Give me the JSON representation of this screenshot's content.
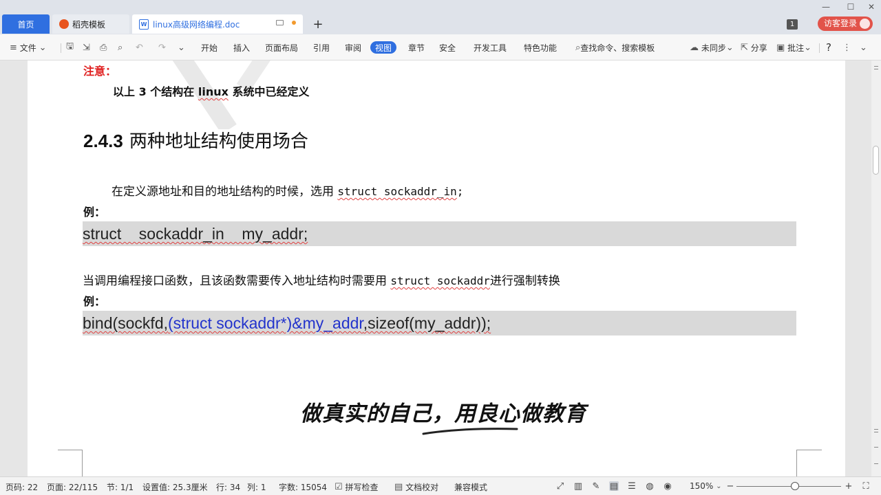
{
  "tabs": {
    "home": "首页",
    "templates": "稻壳模板",
    "document": "linux高级网络编程.doc",
    "add": "+"
  },
  "window": {
    "badge": "1",
    "login": "访客登录"
  },
  "toolbar": {
    "file_menu": "文件",
    "ribbon": [
      "开始",
      "插入",
      "页面布局",
      "引用",
      "审阅",
      "视图",
      "章节",
      "安全",
      "开发工具",
      "特色功能"
    ],
    "active_ribbon": "视图",
    "search": "查找命令、搜索模板",
    "sync": "未同步",
    "share": "分享",
    "comment": "批注",
    "help": "?"
  },
  "document": {
    "note_label": "注意：",
    "note_text": "以上 3 个结构在 linux 系统中已经定义",
    "heading_number": "2.4.3",
    "heading_title": "两种地址结构使用场合",
    "para1_text": "在定义源地址和目的地址结构的时候，选用 ",
    "para1_code": "struct sockaddr_in",
    "para1_end": ";",
    "example_label": "例：",
    "code1": "struct    sockaddr_in    my_addr;",
    "para2_text": "当调用编程接口函数，且该函数需要传入地址结构时需要用 ",
    "para2_code": "struct sockaddr",
    "para2_end": "进行强制转换",
    "code2_a": "bind(sockfd,",
    "code2_b": "(struct sockaddr*)&my_addr",
    "code2_c": ",sizeof(my_addr));",
    "slogan": "做真实的自己，用良心做教育"
  },
  "statusbar": {
    "page_code": "页码: 22",
    "page": "页面: 22/115",
    "section": "节: 1/1",
    "setting": "设置值: 25.3厘米",
    "row": "行: 34",
    "col": "列: 1",
    "word_count": "字数: 15054",
    "spell_check": "拼写检查",
    "doc_proof": "文档校对",
    "compat_mode": "兼容模式",
    "zoom": "150%"
  },
  "colors": {
    "accent": "#2f6fe0",
    "login": "#e2534a",
    "note_red": "#e02020",
    "code_blue": "#2233cc"
  }
}
